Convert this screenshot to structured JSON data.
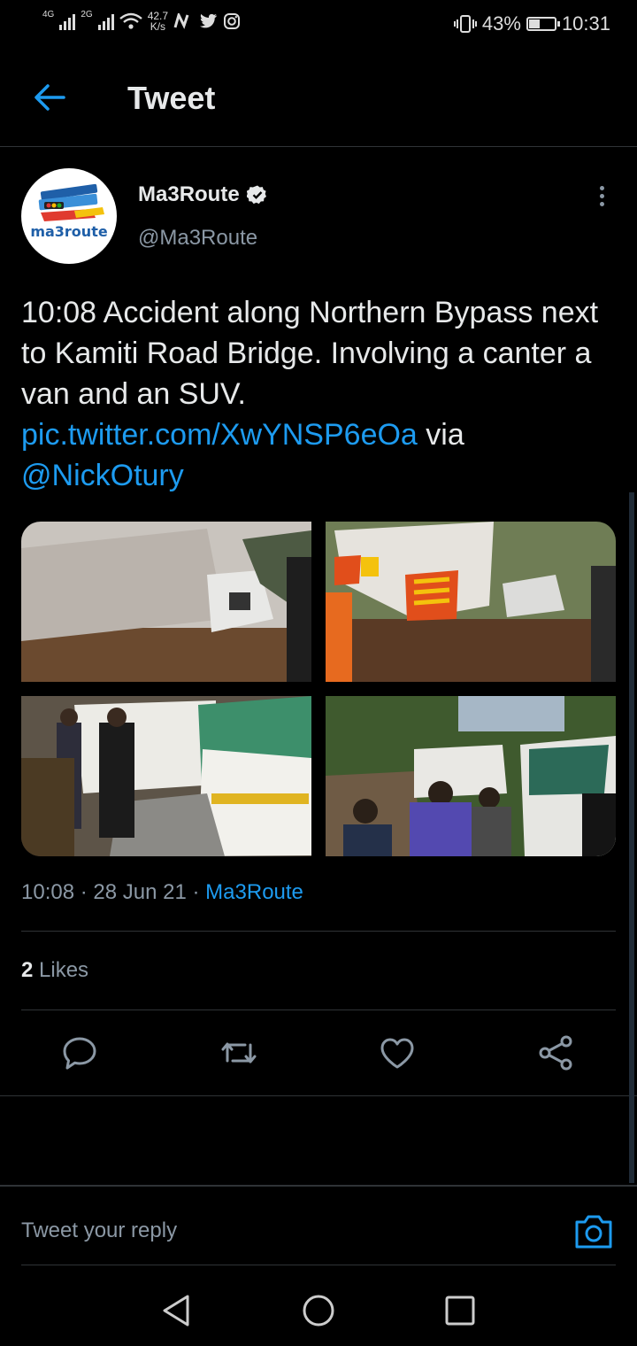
{
  "status_bar": {
    "net1": "4G",
    "net2": "2G",
    "speed_value": "42.7",
    "speed_unit": "K/s",
    "battery_percent": "43%",
    "battery_level": 0.43,
    "time": "10:31"
  },
  "header": {
    "title": "Tweet"
  },
  "author": {
    "name": "Ma3Route",
    "handle": "@Ma3Route",
    "avatar_logo_text": "ma3route",
    "verified": true
  },
  "tweet": {
    "text": "10:08 Accident along Northern Bypass next to Kamiti Road Bridge. Involving a canter a van and an SUV.",
    "link": "pic.twitter.com/XwYNSP6eOa",
    "via_word": "via",
    "mention": "@NickOtury"
  },
  "meta": {
    "time": "10:08",
    "sep": "·",
    "date": "28 Jun 21",
    "source": "Ma3Route"
  },
  "stats": {
    "likes_count": "2",
    "likes_label": "Likes"
  },
  "actions": [
    "reply-icon",
    "retweet-icon",
    "like-icon",
    "share-icon"
  ],
  "reply": {
    "placeholder": "Tweet your reply"
  },
  "colors": {
    "accent": "#1d9bf0",
    "background": "#000000",
    "secondary_text": "#8b98a5"
  }
}
